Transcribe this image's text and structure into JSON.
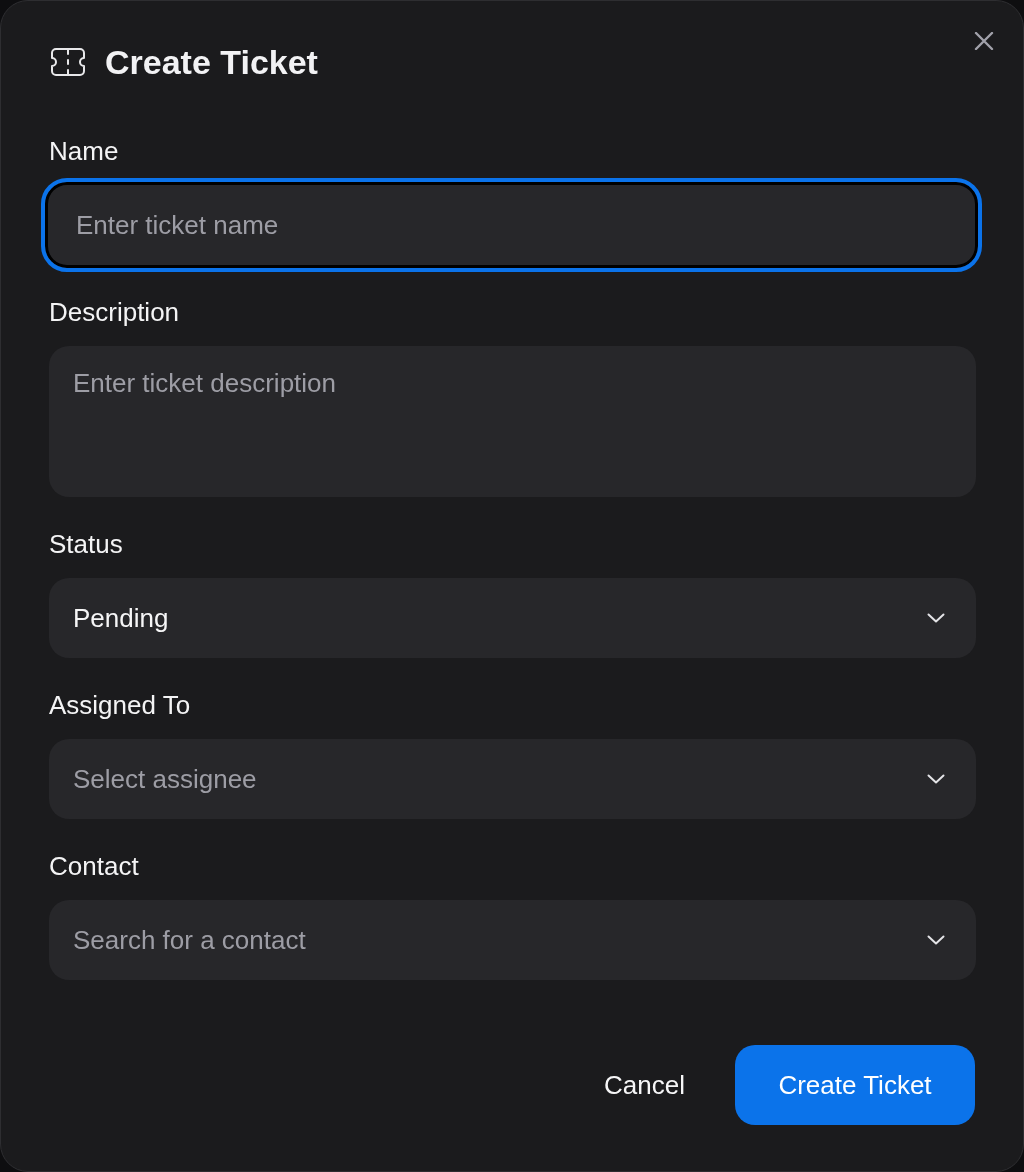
{
  "dialog": {
    "title": "Create Ticket"
  },
  "fields": [
    {
      "kind": "text",
      "label": "Name",
      "placeholder": "Enter ticket name",
      "focused": true
    },
    {
      "kind": "textarea",
      "label": "Description",
      "placeholder": "Enter ticket description",
      "focused": false
    },
    {
      "kind": "select",
      "label": "Status",
      "value": "Pending",
      "focused": false
    },
    {
      "kind": "select",
      "label": "Assigned To",
      "placeholder": "Select assignee",
      "focused": false
    },
    {
      "kind": "combobox",
      "label": "Contact",
      "placeholder": "Search for a contact",
      "focused": false
    }
  ],
  "buttons": [
    {
      "kind": "secondary",
      "label": "Cancel"
    },
    {
      "kind": "primary",
      "label": "Create Ticket"
    }
  ]
}
